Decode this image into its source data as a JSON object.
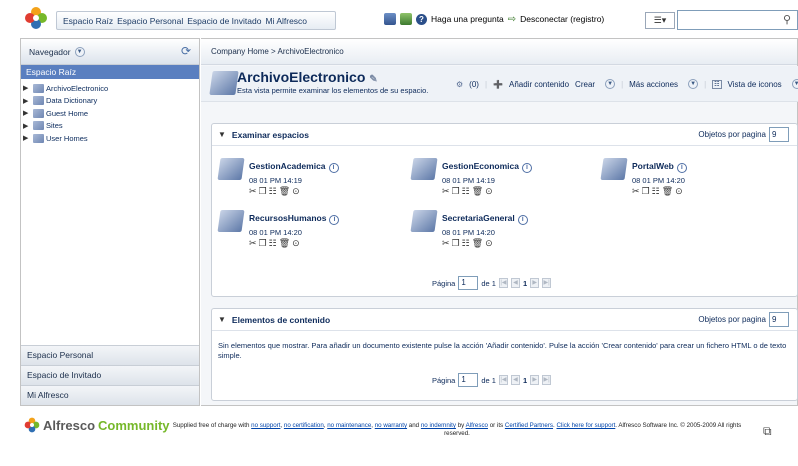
{
  "topbar": {
    "nav": [
      "Espacio Raíz",
      "Espacio Personal",
      "Espacio de Invitado",
      "Mi Alfresco"
    ],
    "help_label": "Haga una pregunta",
    "logout_label": "Desconectar (registro)",
    "search_value": ""
  },
  "sidebar": {
    "title": "Navegador",
    "selected": "Espacio Raíz",
    "tree": [
      "ArchivoElectronico",
      "Data Dictionary",
      "Guest Home",
      "Sites",
      "User Homes"
    ],
    "panels": [
      "Espacio Personal",
      "Espacio de Invitado",
      "Mi Alfresco"
    ]
  },
  "main": {
    "breadcrumb": "Company Home > ArchivoElectronico",
    "title": "ArchivoElectronico",
    "subtitle": "Esta vista permite examinar los elementos de su espacio.",
    "rules_count": "(0)",
    "actions": {
      "add_content": "Añadir contenido",
      "create": "Crear",
      "more_actions": "Más acciones",
      "view": "Vista de iconos"
    }
  },
  "spaces_panel": {
    "title": "Examinar espacios",
    "per_page_label": "Objetos por pagina",
    "per_page_value": "9",
    "spaces": [
      {
        "name": "GestionAcademica",
        "date": "08 01 PM 14:19"
      },
      {
        "name": "GestionEconomica",
        "date": "08 01 PM 14:19"
      },
      {
        "name": "PortalWeb",
        "date": "08 01 PM 14:20"
      },
      {
        "name": "RecursosHumanos",
        "date": "08 01 PM 14:20"
      },
      {
        "name": "SecretariaGeneral",
        "date": "08 01 PM 14:20"
      }
    ],
    "pager": {
      "label": "Página",
      "value": "1",
      "of": "de 1",
      "current": "1"
    }
  },
  "content_panel": {
    "title": "Elementos de contenido",
    "per_page_label": "Objetos por pagina",
    "per_page_value": "9",
    "empty_message": "Sin elementos que mostrar. Para añadir un documento existente pulse la acción 'Añadir contenido'. Pulse la acción 'Crear contenido' para crear un fichero HTML o de texto simple.",
    "pager": {
      "label": "Página",
      "value": "1",
      "of": "de 1",
      "current": "1"
    }
  },
  "footer": {
    "brand_a": "Alfresco",
    "brand_b": "Community",
    "p1": "Supplied free of charge with",
    "l1": "no support",
    "l2": "no certification",
    "l3": "no maintenance",
    "l4": "no warranty",
    "p2": "and",
    "l5": "no indemnity",
    "p3": "by",
    "l6": "Alfresco",
    "p4": "or its",
    "l7": "Certified Partners",
    "l8": "Click here for support",
    "p5": "Alfresco Software Inc. © 2005-2009 All rights reserved."
  }
}
